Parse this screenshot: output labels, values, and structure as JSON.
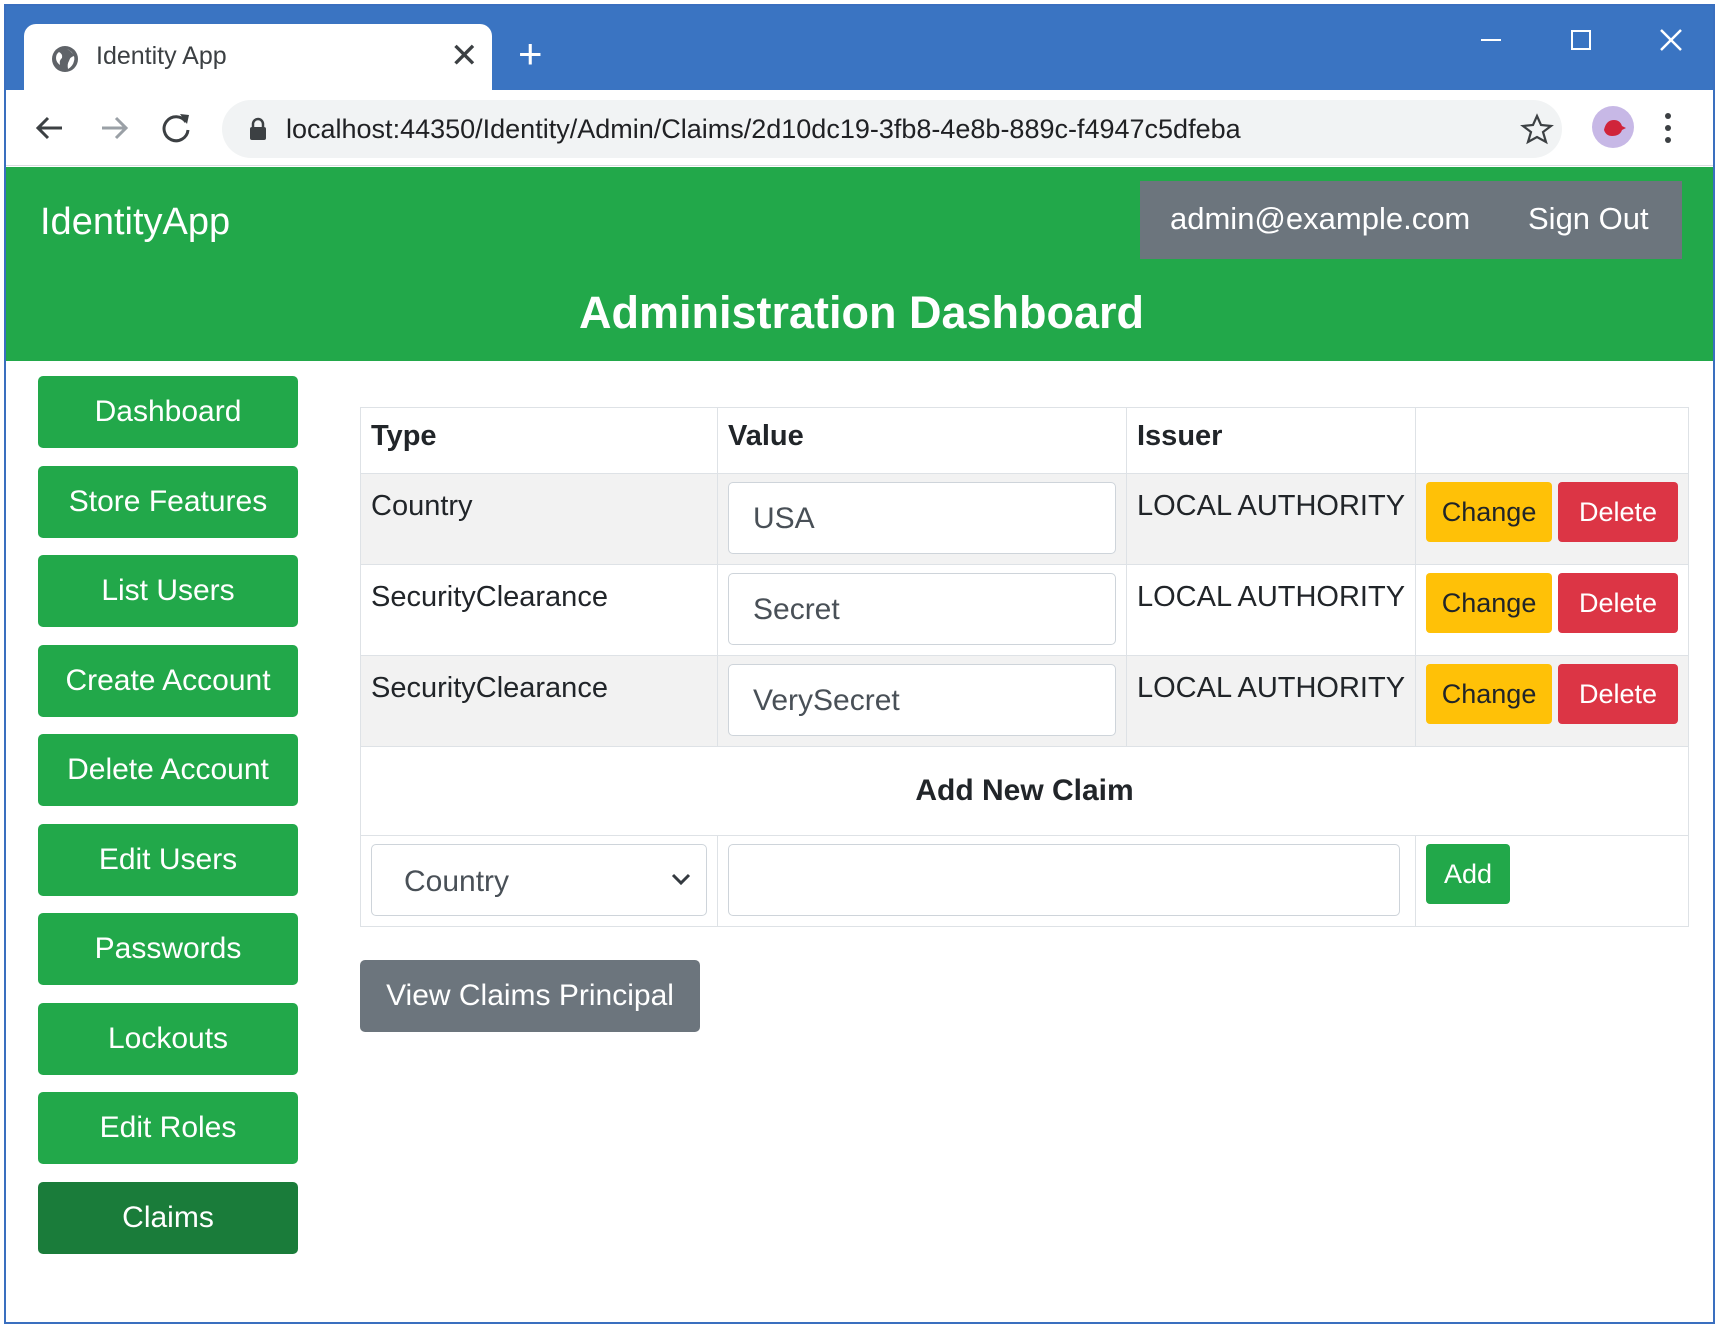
{
  "browser": {
    "tab_title": "Identity App",
    "tab_close_glyph": "✕",
    "new_tab_glyph": "+",
    "url": "localhost:44350/Identity/Admin/Claims/2d10dc19-3fb8-4e8b-889c-f4947c5dfeba",
    "icons": [
      "globe-icon",
      "back-icon",
      "forward-icon",
      "reload-icon",
      "lock-icon",
      "star-icon",
      "avatar",
      "menu-icon",
      "minimize-icon",
      "maximize-icon",
      "close-icon"
    ],
    "titlebar_color": "#3a74c2"
  },
  "header": {
    "brand": "IdentityApp",
    "user_email": "admin@example.com",
    "sign_out": "Sign Out",
    "title": "Administration Dashboard",
    "color": "#22a84a"
  },
  "sidebar": {
    "items": [
      {
        "label": "Dashboard"
      },
      {
        "label": "Store Features"
      },
      {
        "label": "List Users"
      },
      {
        "label": "Create Account"
      },
      {
        "label": "Delete Account"
      },
      {
        "label": "Edit Users"
      },
      {
        "label": "Passwords"
      },
      {
        "label": "Lockouts"
      },
      {
        "label": "Edit Roles"
      },
      {
        "label": "Claims",
        "active": true
      }
    ]
  },
  "table": {
    "headers": {
      "type": "Type",
      "value": "Value",
      "issuer": "Issuer",
      "actions": ""
    },
    "rows": [
      {
        "type": "Country",
        "value": "USA",
        "issuer": "LOCAL AUTHORITY"
      },
      {
        "type": "SecurityClearance",
        "value": "Secret",
        "issuer": "LOCAL AUTHORITY"
      },
      {
        "type": "SecurityClearance",
        "value": "VerySecret",
        "issuer": "LOCAL AUTHORITY"
      }
    ],
    "change_label": "Change",
    "delete_label": "Delete"
  },
  "add_claim": {
    "heading": "Add New Claim",
    "selected_type": "Country",
    "value": "",
    "add_label": "Add"
  },
  "view_principal_label": "View Claims Principal"
}
